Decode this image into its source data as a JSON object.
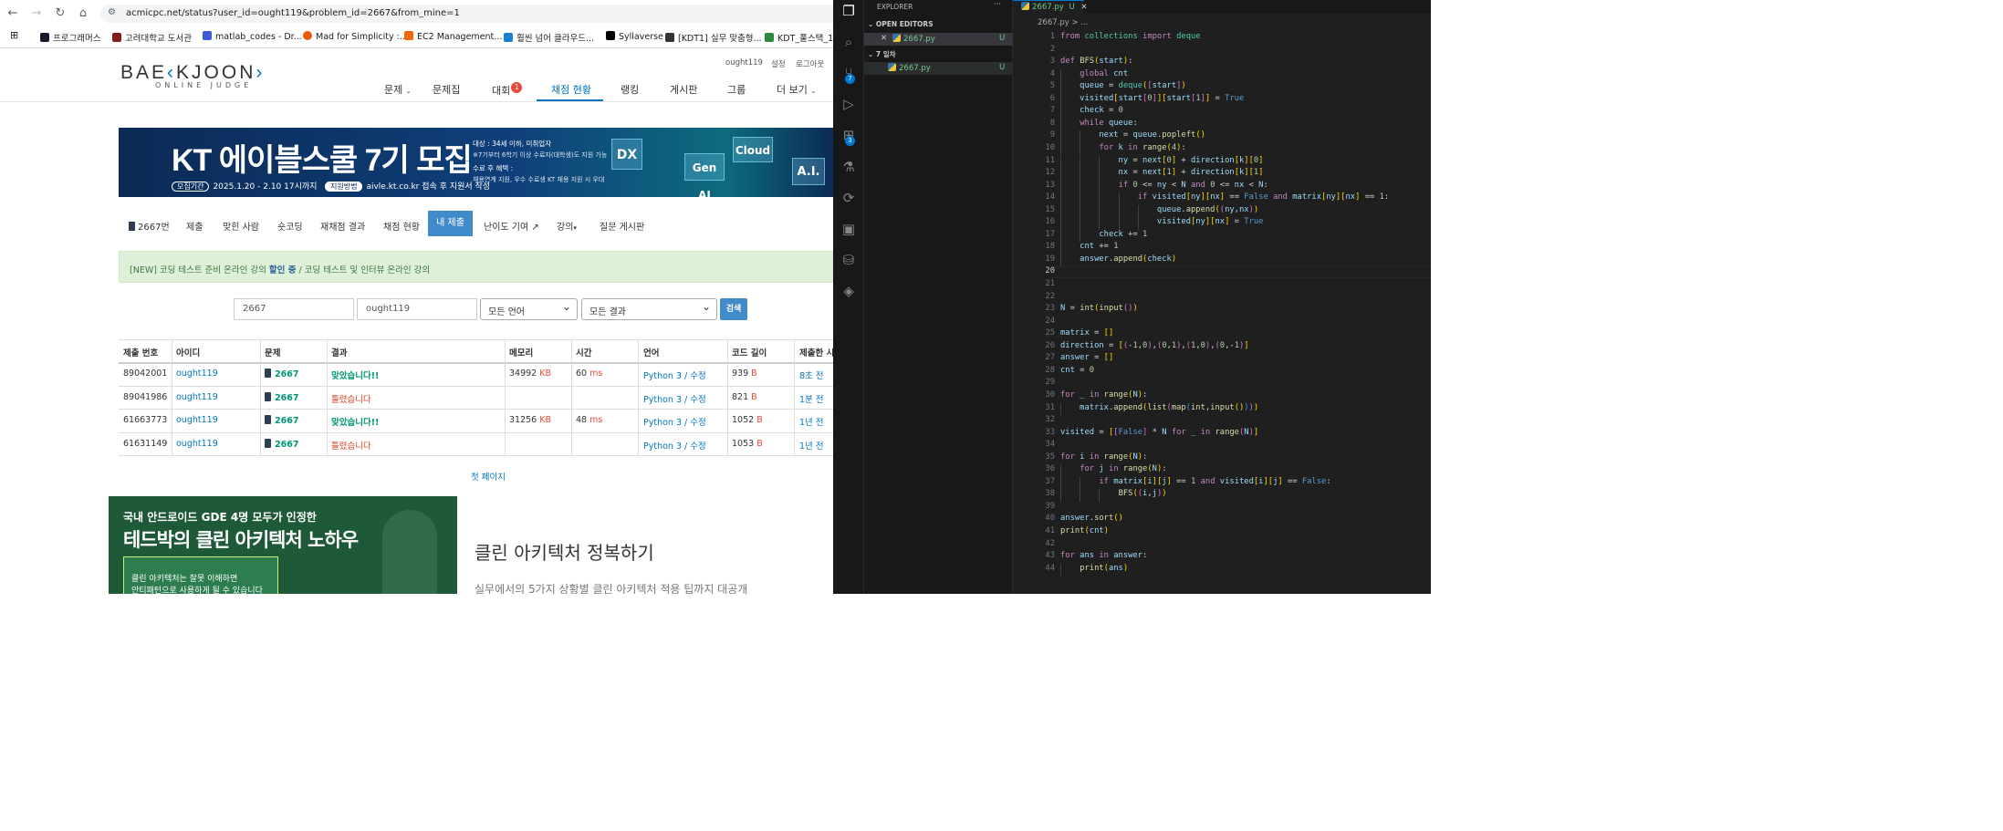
{
  "browser": {
    "url": "acmicpc.net/status?user_id=ought119&problem_id=2667&from_mine=1",
    "bookmarks": [
      "프로그래머스",
      "고려대학교 도서관",
      "matlab_codes - Dr...",
      "Mad for Simplicity :...",
      "EC2 Management...",
      "훨씬 넘어 클라우드...",
      "Syllaverse",
      "[KDT1] 실무 맞춤형...",
      "KDT_풀스택_1기"
    ]
  },
  "site": {
    "logo": "BAEKJOON",
    "logo_sub": "ONLINE JUDGE",
    "user_links": [
      "ought119",
      "설정",
      "로그아웃"
    ],
    "menu": [
      "문제",
      "문제집",
      "대회",
      "채점 현황",
      "랭킹",
      "게시판",
      "그룹",
      "더 보기"
    ],
    "contest_badge": "1",
    "banner": {
      "title": "KT 에이블스쿨 7기 모집",
      "period_label": "모집기간",
      "period": "2025.1.20 - 2.10 17시까지",
      "apply_label": "지원방법",
      "apply": "aivle.kt.co.kr 접속 후 지원서 작성",
      "target": "대상 : 34세 이하, 미취업자",
      "target_note": "※7기부터 6학기 이상 수료자(대학생)도 지원 가능",
      "benefit_label": "수료 후 혜택 :",
      "benefit": "채용연계 지원, 우수 수료생 KT 채용 지원 시 우대",
      "cubes": [
        "DX",
        "Gen AI",
        "Cloud",
        "A.I."
      ]
    },
    "problem_tabs": [
      "2667번",
      "제출",
      "맞힌 사람",
      "숏코딩",
      "재채점 결과",
      "채점 현황",
      "내 제출",
      "난이도 기여",
      "강의",
      "질문 게시판"
    ],
    "notice": {
      "prefix": "[NEW] 코딩 테스트 준비 온라인 강의 ",
      "highlight": "할인 중",
      "suffix": " / 코딩 테스트 및 인터뷰 온라인 강의"
    },
    "search": {
      "problem_id": "2667",
      "user_id": "ought119",
      "language": "모든 언어",
      "result": "모든 결과",
      "button": "검색"
    },
    "table": {
      "headers": [
        "제출 번호",
        "아이디",
        "문제",
        "결과",
        "메모리",
        "시간",
        "언어",
        "코드 길이",
        "제출한 시간"
      ],
      "rows": [
        {
          "id": "89042001",
          "user": "ought119",
          "problem": "2667",
          "result": "맞았습니다!!",
          "memory": "34992",
          "mem_unit": "KB",
          "time": "60",
          "time_unit": "ms",
          "lang": "Python 3",
          "edit": "수정",
          "length": "939",
          "len_unit": "B",
          "when": "8초 전"
        },
        {
          "id": "89041986",
          "user": "ought119",
          "problem": "2667",
          "result": "틀렸습니다",
          "memory": "",
          "mem_unit": "",
          "time": "",
          "time_unit": "",
          "lang": "Python 3",
          "edit": "수정",
          "length": "821",
          "len_unit": "B",
          "when": "1분 전"
        },
        {
          "id": "61663773",
          "user": "ought119",
          "problem": "2667",
          "result": "맞았습니다!!",
          "memory": "31256",
          "mem_unit": "KB",
          "time": "48",
          "time_unit": "ms",
          "lang": "Python 3",
          "edit": "수정",
          "length": "1052",
          "len_unit": "B",
          "when": "1년 전"
        },
        {
          "id": "61631149",
          "user": "ought119",
          "problem": "2667",
          "result": "틀렸습니다",
          "memory": "",
          "mem_unit": "",
          "time": "",
          "time_unit": "",
          "lang": "Python 3",
          "edit": "수정",
          "length": "1053",
          "len_unit": "B",
          "when": "1년 전"
        }
      ],
      "first_page": "첫 페이지"
    },
    "ad": {
      "line1": "국내 안드로이드 GDE 4명 모두가 인정한",
      "line2": "테드박의 클린 아키텍처 노하우",
      "line3": "클린 아키텍처는 잘못 이해하면",
      "line4": "안티패턴으로 사용하게 될 수 있습니다",
      "title": "클린 아키텍처 정복하기",
      "subtitle": "실무에서의 5가지 상황별 클린 아키텍처 적용 팁까지 대공개"
    }
  },
  "vscode": {
    "explorer_title": "EXPLORER",
    "open_editors": "OPEN EDITORS",
    "folder": "7 일차",
    "file": "2667.py",
    "file_status": "U",
    "tab_label": "2667.py",
    "breadcrumb": "2667.py > ...",
    "activity_badges": [
      "7",
      "3"
    ],
    "code": [
      "from collections import deque",
      "",
      "def BFS(start):",
      "    global cnt",
      "    queue = deque([start])",
      "    visited[start[0]][start[1]] = True",
      "    check = 0",
      "    while queue:",
      "        next = queue.popleft()",
      "        for k in range(4):",
      "            ny = next[0] + direction[k][0]",
      "            nx = next[1] + direction[k][1]",
      "            if 0 <= ny < N and 0 <= nx < N:",
      "                if visited[ny][nx] == False and matrix[ny][nx] == 1:",
      "                    queue.append((ny,nx))",
      "                    visited[ny][nx] = True",
      "        check += 1",
      "    cnt += 1",
      "    answer.append(check)",
      "",
      "",
      "",
      "N = int(input())",
      "",
      "matrix = []",
      "direction = [(-1,0),(0,1),(1,0),(0,-1)]",
      "answer = []",
      "cnt = 0",
      "",
      "for _ in range(N):",
      "    matrix.append(list(map(int,input())))",
      "",
      "visited = [[False] * N for _ in range(N)]",
      "",
      "for i in range(N):",
      "    for j in range(N):",
      "        if matrix[i][j] == 1 and visited[i][j] == False:",
      "            BFS((i,j))",
      "",
      "answer.sort()",
      "print(cnt)",
      "",
      "for ans in answer:",
      "    print(ans)"
    ]
  }
}
